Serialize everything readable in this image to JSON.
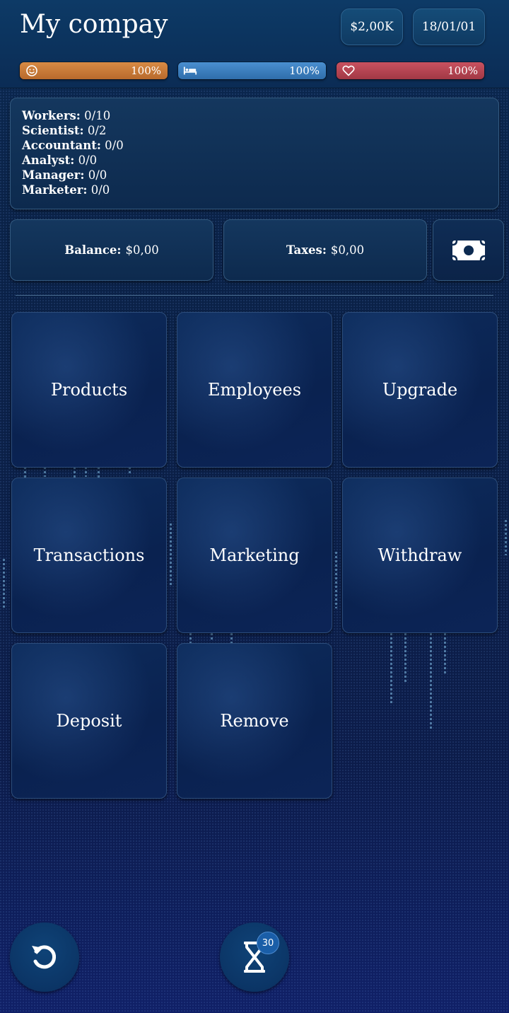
{
  "header": {
    "title": "My compay",
    "money": "$2,00K",
    "date": "18/01/01"
  },
  "status_bars": [
    {
      "icon": "smile-icon",
      "value": "100%",
      "level": 1.0,
      "color": "#c87a37"
    },
    {
      "icon": "bed-icon",
      "value": "100%",
      "level": 1.0,
      "color": "#3a7fc0"
    },
    {
      "icon": "heart-icon",
      "value": "100%",
      "level": 1.0,
      "color": "#b84450"
    }
  ],
  "staff": {
    "workers": {
      "label": "Workers:",
      "value": "0/10"
    },
    "scientist": {
      "label": "Scientist:",
      "value": "0/2"
    },
    "accountant": {
      "label": "Accountant:",
      "value": "0/0"
    },
    "analyst": {
      "label": "Analyst:",
      "value": "0/0"
    },
    "manager": {
      "label": "Manager:",
      "value": "0/0"
    },
    "marketer": {
      "label": "Marketer:",
      "value": "0/0"
    }
  },
  "finance": {
    "balance_label": "Balance:",
    "balance_value": "$0,00",
    "taxes_label": "Taxes:",
    "taxes_value": "$0,00",
    "cash_icon": "banknote-icon"
  },
  "menu": {
    "products": "Products",
    "employees": "Employees",
    "upgrade": "Upgrade",
    "transactions": "Transactions",
    "marketing": "Marketing",
    "withdraw": "Withdraw",
    "deposit": "Deposit",
    "remove": "Remove"
  },
  "footer": {
    "undo_icon": "undo-icon",
    "timer_icon": "hourglass-icon",
    "timer_badge": "30"
  }
}
